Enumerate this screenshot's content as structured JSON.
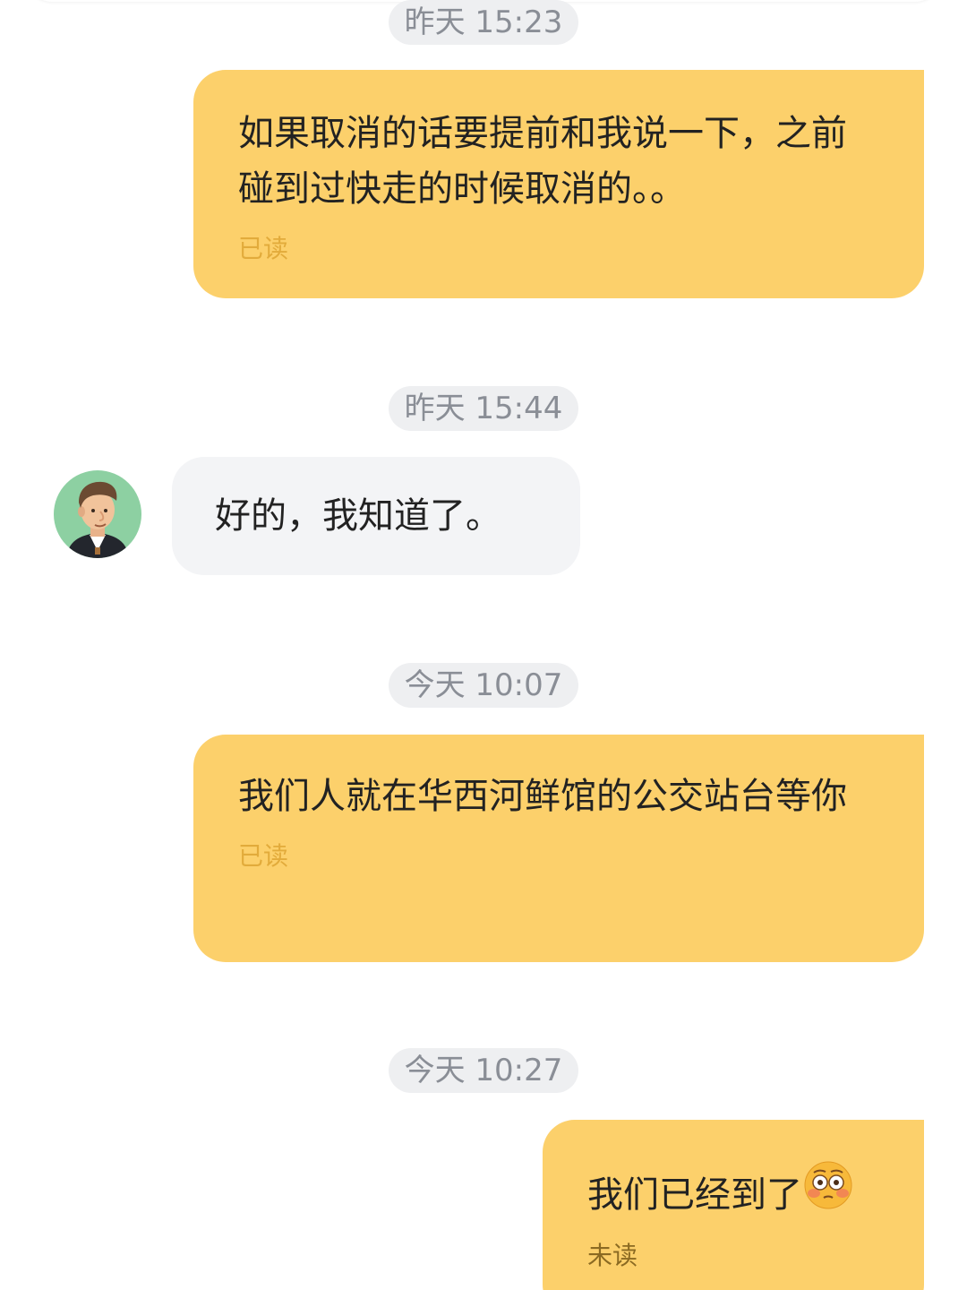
{
  "conversation": {
    "messages": [
      {
        "timestamp": "昨天 15:23",
        "side": "outgoing",
        "text": "如果取消的话要提前和我说一下，之前碰到过快走的时候取消的。。",
        "status": "已读"
      },
      {
        "timestamp": "昨天 15:44",
        "side": "incoming",
        "text": "好的，我知道了。",
        "avatar_icon": "male-user-avatar-icon"
      },
      {
        "timestamp": "今天 10:07",
        "side": "outgoing",
        "text": "我们人就在华西河鲜馆的公交站台等你",
        "status": "已读"
      },
      {
        "timestamp": "今天 10:27",
        "side": "outgoing",
        "text": "我们已经到了",
        "emoji": "flushed-face-emoji-icon",
        "status": "未读"
      }
    ]
  },
  "colors": {
    "outgoing_bubble": "#fcd06b",
    "incoming_bubble": "#f3f4f6",
    "timestamp_pill": "#eeeff1",
    "timestamp_text": "#8a8e96",
    "read_status": "#e2ab3b",
    "unread_status": "#8b6a22",
    "avatar_bg": "#8dd0a2"
  }
}
